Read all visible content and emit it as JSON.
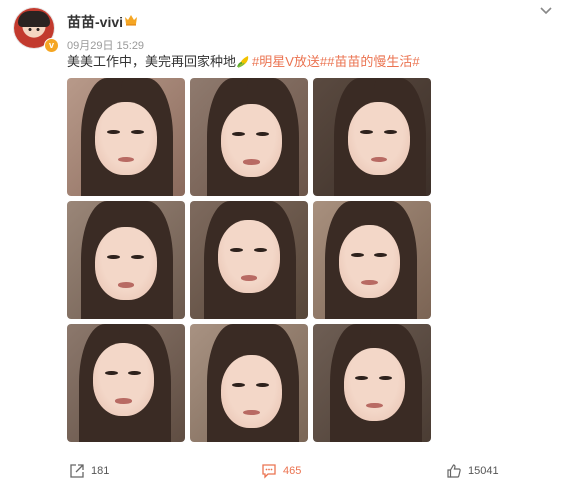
{
  "user": {
    "name": "苗苗-vivi",
    "verified_mark": "v"
  },
  "post": {
    "time": "09月29日 15:29",
    "text_plain": "美美工作中，美完再回家种地",
    "tags": [
      "#明星V放送#",
      "#苗苗的慢生活#"
    ],
    "emoji_icon": "corn-icon"
  },
  "photos": [
    {
      "id": 1
    },
    {
      "id": 2
    },
    {
      "id": 3
    },
    {
      "id": 4
    },
    {
      "id": 5
    },
    {
      "id": 6
    },
    {
      "id": 7
    },
    {
      "id": 8
    },
    {
      "id": 9
    }
  ],
  "actions": {
    "repost": {
      "count": "181",
      "icon": "share-icon"
    },
    "comment": {
      "count": "465",
      "icon": "comment-icon"
    },
    "like": {
      "count": "15041",
      "icon": "thumbs-up-icon"
    }
  },
  "colors": {
    "accent": "#eb7350",
    "text": "#333333",
    "muted": "#999999",
    "vip": "#f5a623"
  }
}
